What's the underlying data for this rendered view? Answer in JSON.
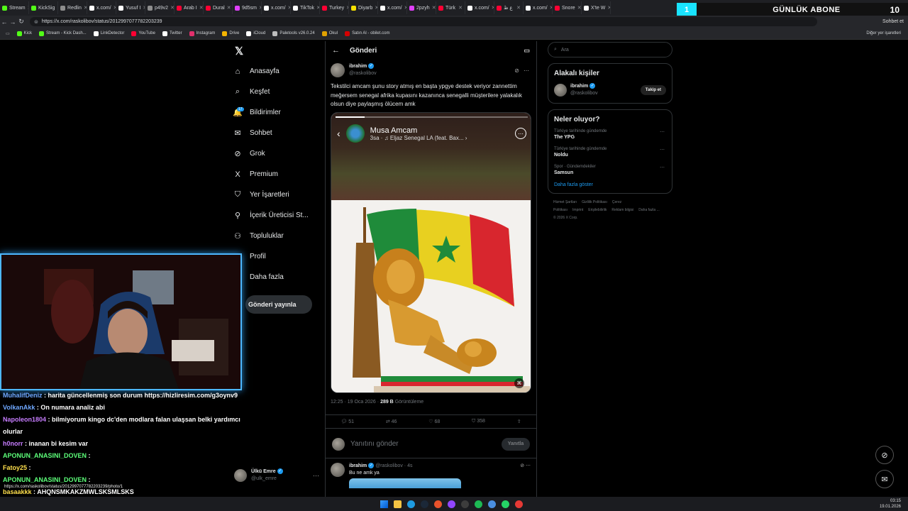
{
  "browser": {
    "tabs": [
      {
        "label": "Stream",
        "color": "#53fc18"
      },
      {
        "label": "KickSig",
        "color": "#53fc18"
      },
      {
        "label": "Redlin",
        "color": "#8e8e8e"
      },
      {
        "label": "x.com/",
        "color": "#ffffff"
      },
      {
        "label": "Yusuf I",
        "color": "#ffffff"
      },
      {
        "label": "p49v2",
        "color": "#8e8e8e"
      },
      {
        "label": "Arab I",
        "color": "#ff0033"
      },
      {
        "label": "Dural",
        "color": "#ff0033"
      },
      {
        "label": "9d5sm",
        "color": "#e040fb"
      },
      {
        "label": "x.com/",
        "color": "#ffffff"
      },
      {
        "label": "TikTok",
        "color": "#ffffff"
      },
      {
        "label": "Turkey",
        "color": "#ff0033"
      },
      {
        "label": "Diyarb",
        "color": "#f5e000"
      },
      {
        "label": "x.com/",
        "color": "#ffffff"
      },
      {
        "label": "2pzyh",
        "color": "#e040fb"
      },
      {
        "label": "Türk",
        "color": "#ff0033"
      },
      {
        "label": "x.com/",
        "color": "#ffffff"
      },
      {
        "label": "ع ظ",
        "color": "#ff0033"
      },
      {
        "label": "x.com/",
        "color": "#ffffff"
      },
      {
        "label": "Snore",
        "color": "#ff0033"
      },
      {
        "label": "X'te W",
        "color": "#ffffff"
      }
    ],
    "url": "https://x.com/raskolibov/status/2012997077782203239",
    "bookmarks": [
      {
        "label": "Kick",
        "color": "#53fc18"
      },
      {
        "label": "Stream - Kick Dash...",
        "color": "#53fc18"
      },
      {
        "label": "LinkDetector",
        "color": "#ffffff"
      },
      {
        "label": "YouTube",
        "color": "#ff0033"
      },
      {
        "label": "Twitter",
        "color": "#ffffff"
      },
      {
        "label": "Instagram",
        "color": "#e1306c"
      },
      {
        "label": "Drive",
        "color": "#f4b400"
      },
      {
        "label": "iCloud",
        "color": "#ffffff"
      },
      {
        "label": "Paletools v26.0.24",
        "color": "#bdbdbd"
      },
      {
        "label": "Okul",
        "color": "#e0a100"
      },
      {
        "label": "Satın Al - obilet.com",
        "color": "#d50000"
      }
    ],
    "bookmarks_right": "Diğer yer işaretleri",
    "profile_label": "Sohbet et"
  },
  "overlay": {
    "sub_count": "1",
    "sub_label": "GÜNLÜK ABONE",
    "sub_goal": "10"
  },
  "sidenav": {
    "items": [
      {
        "label": "Anasayfa",
        "icon": "⌂",
        "name": "home"
      },
      {
        "label": "Keşfet",
        "icon": "⌕",
        "name": "explore"
      },
      {
        "label": "Bildirimler",
        "icon": "🔔",
        "name": "notifications",
        "badge": "17"
      },
      {
        "label": "Sohbet",
        "icon": "✉",
        "name": "chat"
      },
      {
        "label": "Grok",
        "icon": "⊘",
        "name": "grok"
      },
      {
        "label": "Premium",
        "icon": "X",
        "name": "premium"
      },
      {
        "label": "Yer İşaretleri",
        "icon": "⛉",
        "name": "bookmarks"
      },
      {
        "label": "İçerik Üreticisi St...",
        "icon": "⚲",
        "name": "creator-studio"
      },
      {
        "label": "Topluluklar",
        "icon": "⚇",
        "name": "communities"
      },
      {
        "label": "Profil",
        "icon": "☺",
        "name": "profile"
      },
      {
        "label": "Daha fazla",
        "icon": "⋯",
        "name": "more"
      }
    ],
    "post_button": "Gönderi yayınla",
    "account": {
      "name": "Ülkü Emre",
      "handle": "@ulk_emre"
    }
  },
  "main": {
    "header": "Gönderi",
    "tweet": {
      "author": "ibrahim",
      "handle": "@raskolibov",
      "text": "Tekstilci amcam şunu story atmış en başta ypgye destek veriyor zannettim meğersem senegal afrika kupasını kazanınca senegalli müşterilere yalakalık olsun diye paylaşmış ölücem amk",
      "story": {
        "name": "Musa Amcam",
        "time": "3sa",
        "song": "Eljaz Senegal LA (feat. Bax..."
      },
      "time": "12:25 · 19 Oca 2026",
      "views": "289 B",
      "views_label": "Görüntüleme",
      "replies": "51",
      "retweets": "46",
      "likes": "68",
      "bookmarks": "358"
    },
    "reply_placeholder": "Yanıtını gönder",
    "reply_button": "Yanıtla",
    "reply": {
      "author": "ibrahim",
      "handle": "@raskolibov",
      "time": "4s",
      "text": "Bu ne amk ya"
    }
  },
  "right": {
    "search_placeholder": "Ara",
    "related_title": "Alakalı kişiler",
    "related_user": {
      "name": "ibrahim",
      "handle": "@raskolibov",
      "follow": "Takip et"
    },
    "trends_title": "Neler oluyor?",
    "trends": [
      {
        "context": "Türkiye tarihinde gündemde",
        "name": "The YPG"
      },
      {
        "context": "Türkiye tarihinde gündemde",
        "name": "Noldu"
      },
      {
        "context": "Spor · Gündemdekiler",
        "name": "Samsun"
      }
    ],
    "show_more": "Daha fazla göster",
    "footer_links": [
      "Hizmet Şartları",
      "Gizlilik Politikası",
      "Çerez Politikası",
      "Imprint",
      "Erişilebilirlik",
      "Reklam bilgisi",
      "Daha fazla ..."
    ],
    "copyright": "© 2026 X Corp."
  },
  "chat": {
    "messages": [
      {
        "user": "MuhalifDeniz",
        "color": "#6fa8ff",
        "text": "harita güncellenmiş son durum https://hizliresim.com/g3oynv9"
      },
      {
        "user": "VolkanAkk",
        "color": "#6fa8ff",
        "text": "On numara analiz abi"
      },
      {
        "user": "Napoleon1804",
        "color": "#c77dff",
        "text": "bilmiyorum kingo dc'den modlara falan ulaşsan belki yardımcı olurlar"
      },
      {
        "user": "h0norr",
        "color": "#c77dff",
        "text": "inanan bi kesim var"
      },
      {
        "user": "APONUN_ANASINI_DOVEN",
        "color": "#5dff7a",
        "text": ""
      },
      {
        "user": "Fatoy25",
        "color": "#ffe04d",
        "text": ""
      },
      {
        "user": "APONUN_ANASINI_DOVEN",
        "color": "#5dff7a",
        "text": ""
      },
      {
        "user": "basaakkk",
        "color": "#ffe04d",
        "text": "AHQNSMKAKZMWLSKSMLSKS"
      }
    ],
    "status_url": "https://x.com/raskolibov/status/2012997077782203239/photo/1"
  },
  "taskbar": {
    "time": "03:15",
    "date": "19.01.2026"
  }
}
